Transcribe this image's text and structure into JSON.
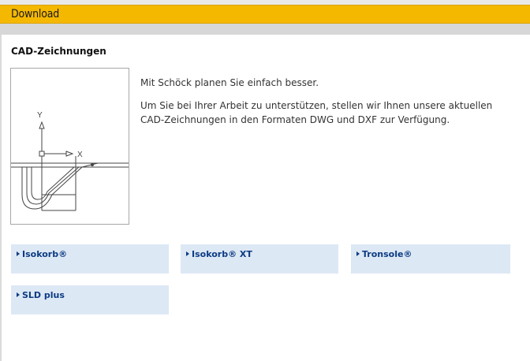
{
  "header": {
    "title": "Download"
  },
  "section": {
    "title": "CAD-Zeichnungen",
    "paragraphs": [
      "Mit Schöck planen Sie einfach besser.",
      "Um Sie bei Ihrer Arbeit zu unterstützen, stellen wir Ihnen unsere aktuellen CAD-Zeichnungen in den Formaten DWG und DXF zur Verfügung."
    ]
  },
  "cad_drawing": {
    "axis_y": "Y",
    "axis_x": "X"
  },
  "links": [
    {
      "label": "Isokorb®"
    },
    {
      "label": "Isokorb® XT"
    },
    {
      "label": "Tronsole®"
    },
    {
      "label": "SLD plus"
    }
  ],
  "colors": {
    "header_bar": "#f5b800",
    "link_box_bg": "#dde8f5",
    "link_text": "#0c3b82"
  }
}
